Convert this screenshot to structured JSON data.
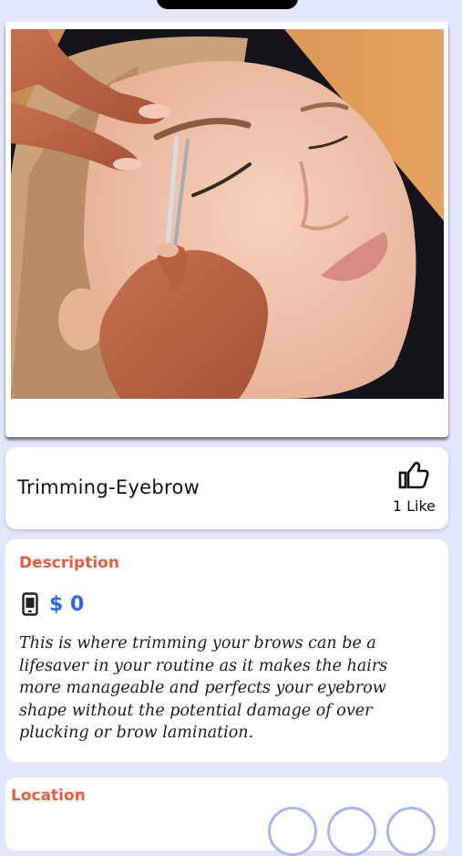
{
  "service": {
    "title": "Trimming-Eyebrow",
    "likes_label": "1 Like"
  },
  "description": {
    "heading": "Description",
    "price": "$ 0",
    "text": "This is where trimming your brows can be a lifesaver in your routine as it makes the hairs more manageable and perfects your eyebrow shape without the potential damage of over plucking or brow lamination."
  },
  "location": {
    "heading": "Location"
  },
  "colors": {
    "accent_heading": "#f05a3b",
    "price_blue": "#2f66e6",
    "background": "#e3e7fb"
  },
  "icons": {
    "like": "thumbs-up-icon",
    "price": "phone-icon"
  }
}
